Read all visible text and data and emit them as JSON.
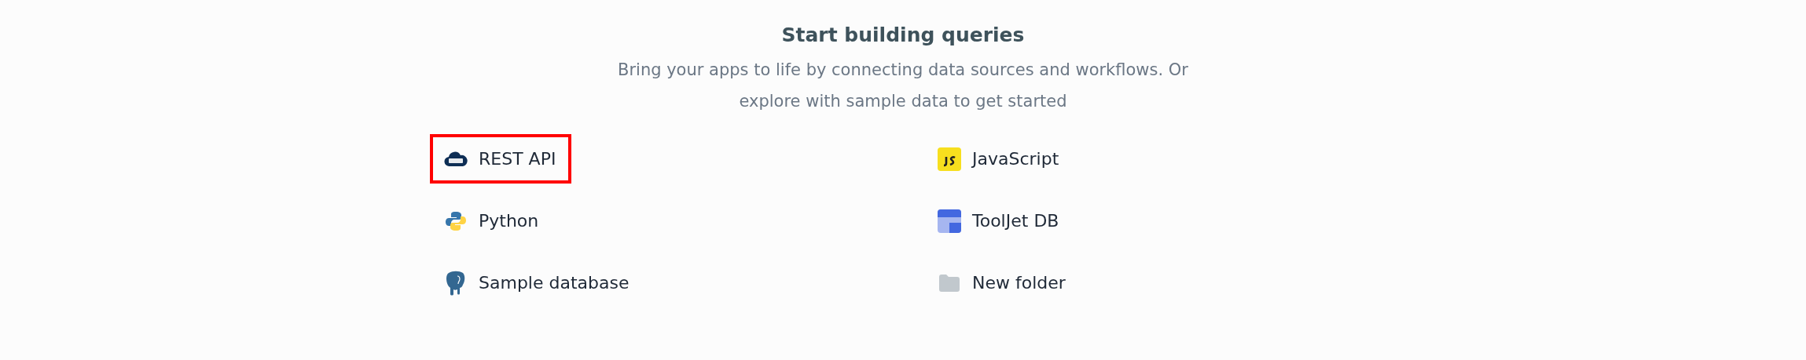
{
  "heading": {
    "title": "Start building queries",
    "description": "Bring your apps to life by connecting data sources and workflows. Or explore with sample data to get started"
  },
  "sources": [
    {
      "label": "REST API",
      "kind": "rest",
      "highlighted": true
    },
    {
      "label": "JavaScript",
      "kind": "javascript",
      "highlighted": false
    },
    {
      "label": "Python",
      "kind": "python",
      "highlighted": false
    },
    {
      "label": "ToolJet DB",
      "kind": "tooljetdb",
      "highlighted": false
    },
    {
      "label": "Sample database",
      "kind": "postgres",
      "highlighted": false
    },
    {
      "label": "New folder",
      "kind": "folder",
      "highlighted": false
    }
  ]
}
